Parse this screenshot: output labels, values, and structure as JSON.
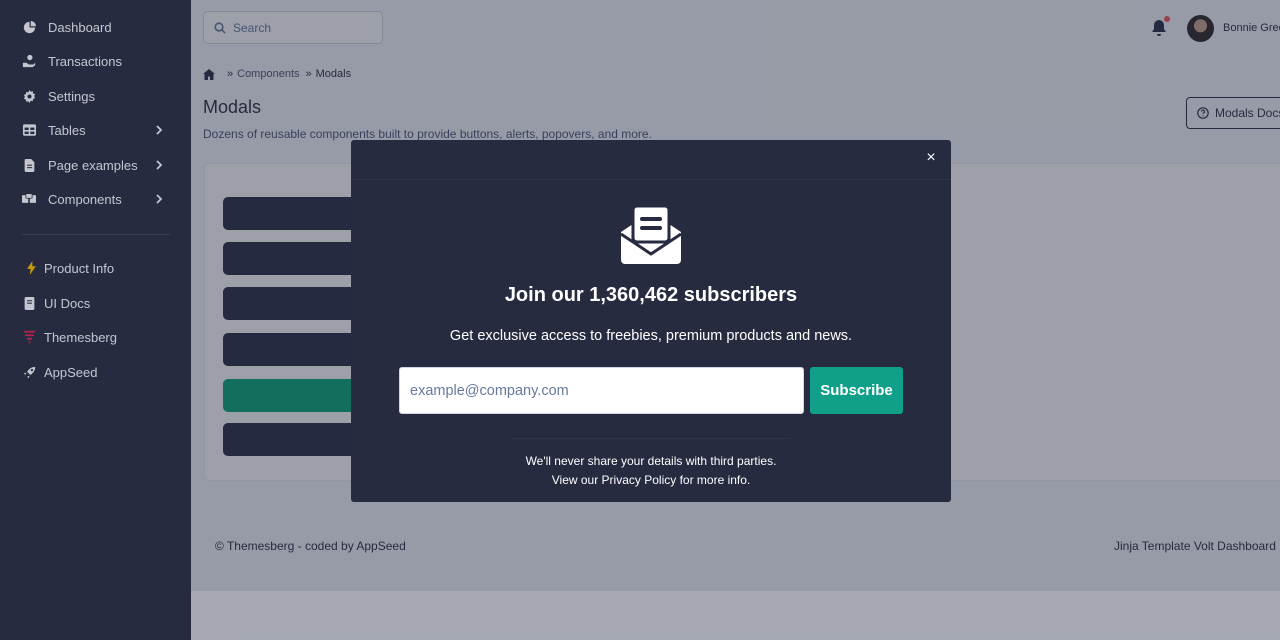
{
  "sidebar": {
    "items": [
      {
        "label": "Dashboard",
        "icon": "pie-chart-icon"
      },
      {
        "label": "Transactions",
        "icon": "hand-coin-icon"
      },
      {
        "label": "Settings",
        "icon": "gear-icon"
      },
      {
        "label": "Tables",
        "icon": "table-icon"
      },
      {
        "label": "Page examples",
        "icon": "document-icon"
      },
      {
        "label": "Components",
        "icon": "boxes-icon"
      },
      {
        "label": "Product Info",
        "icon": "bolt-icon"
      },
      {
        "label": "UI Docs",
        "icon": "book-icon"
      },
      {
        "label": "Themesberg",
        "icon": "themesberg-logo-icon"
      },
      {
        "label": "AppSeed",
        "icon": "rocket-icon"
      }
    ]
  },
  "topbar": {
    "search_placeholder": "Search",
    "user_name": "Bonnie Green"
  },
  "breadcrumb": {
    "components": "Components",
    "current": "Modals"
  },
  "page": {
    "title": "Modals",
    "description": "Dozens of reusable components built to provide buttons, alerts, popovers, and more.",
    "docs_button": "Modals Docs"
  },
  "footer": {
    "left": "© Themesberg - coded by AppSeed",
    "right": "Jinja Template Volt Dashboard"
  },
  "modal": {
    "title": "Join our 1,360,462 subscribers",
    "subtitle": "Get exclusive access to freebies, premium products and news.",
    "email_placeholder": "example@company.com",
    "subscribe_label": "Subscribe",
    "close_label": "×",
    "note_line1": "We'll never share your details with third parties.",
    "note_prefix": "View our ",
    "note_link": "Privacy Policy",
    "note_suffix": " for more info."
  },
  "colors": {
    "sidebar_bg": "#262b40",
    "modal_bg": "#262b40",
    "accent_teal": "#10a08a",
    "notification_dot": "#fa5252"
  }
}
